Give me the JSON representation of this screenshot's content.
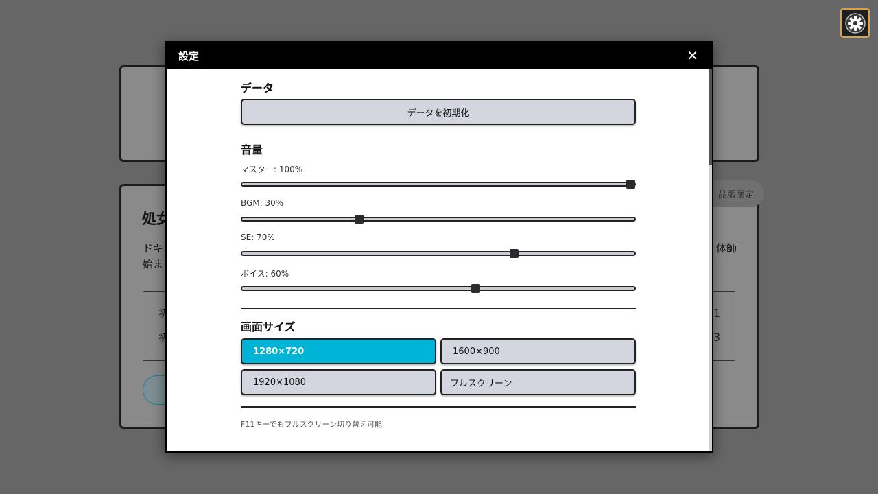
{
  "background": {
    "card_title": "処女",
    "text_left_1": "ドキ",
    "text_left_2": "始ま",
    "text_right": "体師",
    "row1_left": "初",
    "row1_right": "1",
    "row2_left": "初",
    "row2_right": "3",
    "pill_label": "品版限定"
  },
  "settings_button_icon": "gear-icon",
  "modal": {
    "title": "設定",
    "close_label": "✕",
    "data_section": {
      "title": "データ",
      "reset_button": "データを初期化"
    },
    "volume_section": {
      "title": "音量",
      "sliders": [
        {
          "label": "マスター: 100%",
          "value": 100
        },
        {
          "label": "BGM: 30%",
          "value": 30
        },
        {
          "label": "SE: 70%",
          "value": 70
        },
        {
          "label": "ボイス: 60%",
          "value": 60
        }
      ]
    },
    "screen_section": {
      "title": "画面サイズ",
      "options": [
        {
          "label": "1280×720",
          "selected": true
        },
        {
          "label": "1600×900",
          "selected": false
        },
        {
          "label": "1920×1080",
          "selected": false
        },
        {
          "label": "フルスクリーン",
          "selected": false
        }
      ],
      "hint": "F11キーでもフルスクリーン切り替え可能"
    }
  },
  "colors": {
    "accent": "#00b4d8",
    "button_gray": "#d3d6de",
    "overlay": "#666666"
  }
}
